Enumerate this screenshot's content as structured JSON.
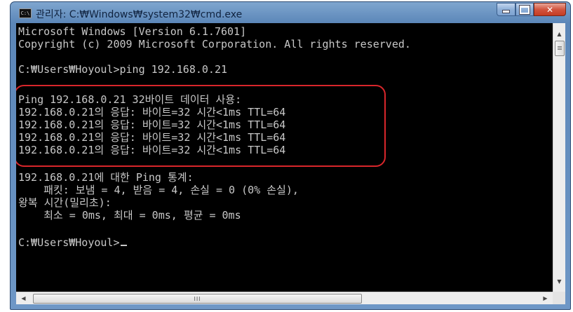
{
  "window": {
    "title": "관리자: C:₩Windows₩system32₩cmd.exe",
    "icon_label": "C:\\",
    "icon": "cmd-app-icon",
    "controls": {
      "minimize": "minimize-icon",
      "maximize": "maximize-icon",
      "close": "close-icon",
      "close_glyph": "✕"
    }
  },
  "console": {
    "lines": [
      "Microsoft Windows [Version 6.1.7601]",
      "Copyright (c) 2009 Microsoft Corporation. All rights reserved.",
      "",
      "C:₩Users₩Hoyoul>ping 192.168.0.21",
      "",
      "Ping 192.168.0.21 32바이트 데이터 사용:",
      "192.168.0.21의 응답: 바이트=32 시간<1ms TTL=64",
      "192.168.0.21의 응답: 바이트=32 시간<1ms TTL=64",
      "192.168.0.21의 응답: 바이트=32 시간<1ms TTL=64",
      "192.168.0.21의 응답: 바이트=32 시간<1ms TTL=64",
      "",
      "192.168.0.21에 대한 Ping 통계:",
      "    패킷: 보냄 = 4, 받음 = 4, 손실 = 0 (0% 손실),",
      "왕복 시간(밀리초):",
      "    최소 = 0ms, 최대 = 0ms, 평균 = 0ms",
      "",
      "C:₩Users₩Hoyoul>"
    ],
    "text_color": "#c8c8c8",
    "background": "#000000",
    "annotation_color": "#d8262b"
  },
  "scrollbars": {
    "up_arrow": "▲",
    "down_arrow": "▼",
    "left_arrow": "◀",
    "right_arrow": "▶",
    "h_thumb_grip": "III"
  }
}
